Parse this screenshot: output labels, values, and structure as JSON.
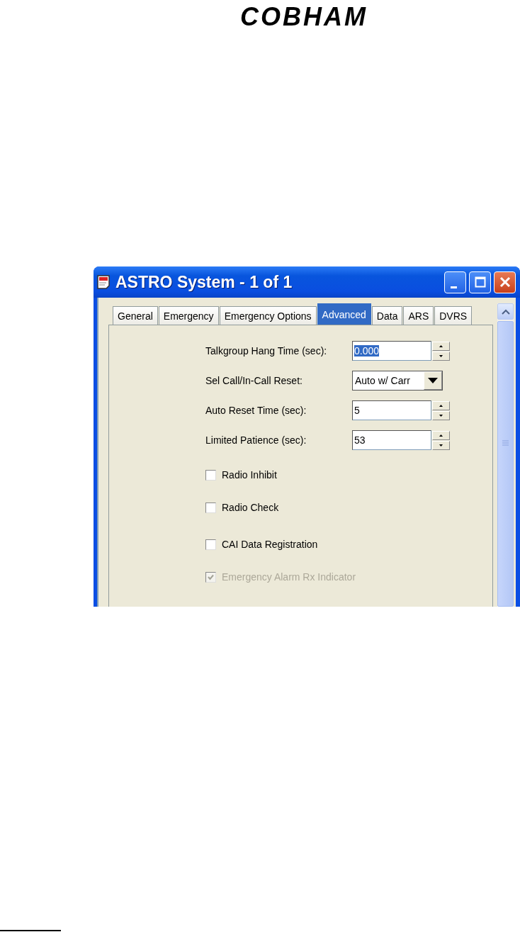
{
  "logo": "COBHAM",
  "window": {
    "title": "ASTRO System - 1 of 1"
  },
  "tabs": [
    {
      "label": "General",
      "selected": false
    },
    {
      "label": "Emergency",
      "selected": false
    },
    {
      "label": "Emergency Options",
      "selected": false
    },
    {
      "label": "Advanced",
      "selected": true
    },
    {
      "label": "Data",
      "selected": false
    },
    {
      "label": "ARS",
      "selected": false
    },
    {
      "label": "DVRS",
      "selected": false
    }
  ],
  "fields": [
    {
      "kind": "spin",
      "label": "Talkgroup Hang Time (sec):",
      "value": "0.000",
      "text_selected": true
    },
    {
      "kind": "dropdown",
      "label": "Sel Call/In-Call Reset:",
      "value": "Auto w/ Carr",
      "text_selected": false
    },
    {
      "kind": "spin",
      "label": "Auto Reset Time (sec):",
      "value": "5",
      "text_selected": false
    },
    {
      "kind": "spin",
      "label": "Limited Patience (sec):",
      "value": "53",
      "text_selected": false
    }
  ],
  "checkboxes": [
    {
      "label": "Radio Inhibit",
      "checked": false,
      "disabled": false
    },
    {
      "label": "Radio Check",
      "checked": false,
      "disabled": false
    },
    {
      "label": "CAI Data Registration",
      "checked": false,
      "disabled": false
    },
    {
      "label": "Emergency Alarm Rx Indicator",
      "checked": true,
      "disabled": true
    }
  ]
}
